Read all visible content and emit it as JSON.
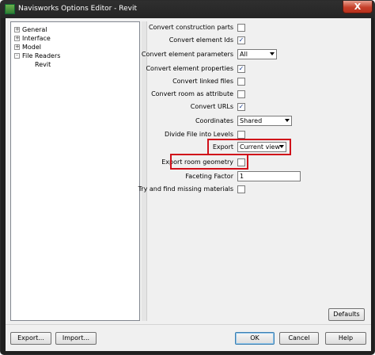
{
  "window": {
    "title": "Navisworks Options Editor - Revit",
    "close_symbol": "X",
    "colors": {
      "frame": "#252525",
      "highlight": "#d0101a",
      "check": "#1a3c8c"
    }
  },
  "tree": {
    "items": [
      {
        "label": "General",
        "expander": "+"
      },
      {
        "label": "Interface",
        "expander": "+"
      },
      {
        "label": "Model",
        "expander": "+"
      },
      {
        "label": "File Readers",
        "expander": "-"
      },
      {
        "label": "Revit",
        "expander": ""
      }
    ]
  },
  "options": {
    "convert_construction_parts": {
      "label": "Convert construction parts",
      "checked": false
    },
    "convert_element_ids": {
      "label": "Convert element Ids",
      "checked": true
    },
    "convert_element_parameters": {
      "label": "Convert element parameters",
      "value": "All"
    },
    "convert_element_properties": {
      "label": "Convert element properties",
      "checked": true
    },
    "convert_linked_files": {
      "label": "Convert linked files",
      "checked": false
    },
    "convert_room_as_attribute": {
      "label": "Convert room as attribute",
      "checked": false
    },
    "convert_urls": {
      "label": "Convert URLs",
      "checked": true
    },
    "coordinates": {
      "label": "Coordinates",
      "value": "Shared"
    },
    "divide_file_into_levels": {
      "label": "Divide File into Levels",
      "checked": false
    },
    "export": {
      "label": "Export",
      "value": "Current view"
    },
    "export_room_geometry": {
      "label": "Export room geometry",
      "checked": false
    },
    "faceting_factor": {
      "label": "Faceting Factor",
      "value": "1"
    },
    "try_find_missing_materials": {
      "label": "Try and find missing materials",
      "checked": false
    }
  },
  "check_mark": "✓",
  "buttons": {
    "defaults": "Defaults",
    "export": "Export...",
    "import": "Import...",
    "ok": "OK",
    "cancel": "Cancel",
    "help": "Help"
  }
}
